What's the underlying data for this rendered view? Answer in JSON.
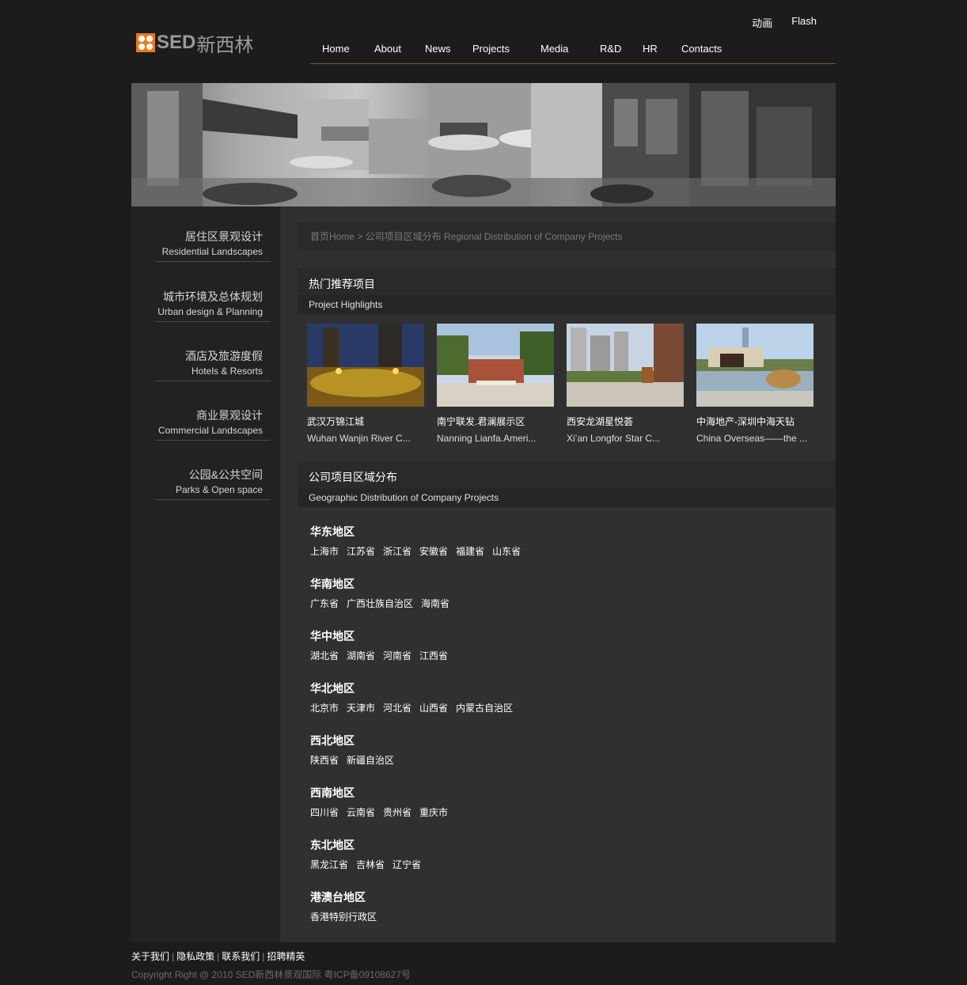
{
  "header": {
    "logo_text": "SED",
    "logo_cn": "新西林",
    "top_links": [
      "动画",
      "Flash"
    ],
    "nav": [
      "Home",
      "About",
      "News",
      "Projects",
      "Media",
      "R&D",
      "HR",
      "Contacts"
    ]
  },
  "sidebar": {
    "items": [
      {
        "cn": "居住区景观设计",
        "en": "Residential Landscapes"
      },
      {
        "cn": "城市环境及总体规划",
        "en": "Urban design & Planning"
      },
      {
        "cn": "酒店及旅游度假",
        "en": "Hotels & Resorts"
      },
      {
        "cn": "商业景观设计",
        "en": "Commercial Landscapes"
      },
      {
        "cn": "公园&公共空间",
        "en": "Parks & Open space"
      }
    ]
  },
  "breadcrumb": "首页Home > 公司项目区域分布 Regional Distribution of Company Projects",
  "highlights": {
    "title_cn": "热门推荐项目",
    "title_en": "Project Highlights",
    "items": [
      {
        "cn": "武汉万锦江城",
        "en": "Wuhan Wanjin River C..."
      },
      {
        "cn": "南宁联发.君澜展示区",
        "en": "Nanning Lianfa.Ameri..."
      },
      {
        "cn": "西安龙湖星悦荟",
        "en": "Xi’an Longfor Star C..."
      },
      {
        "cn": "中海地产-深圳中海天钻",
        "en": "China Overseas——the ..."
      }
    ]
  },
  "distribution": {
    "title_cn": "公司项目区域分布",
    "title_en": "Geographic Distribution of Company Projects",
    "regions": [
      {
        "name": "华东地区",
        "provinces": [
          "上海市",
          "江苏省",
          "浙江省",
          "安徽省",
          "福建省",
          "山东省"
        ]
      },
      {
        "name": "华南地区",
        "provinces": [
          "广东省",
          "广西壮族自治区",
          "海南省"
        ]
      },
      {
        "name": "华中地区",
        "provinces": [
          "湖北省",
          "湖南省",
          "河南省",
          "江西省"
        ]
      },
      {
        "name": "华北地区",
        "provinces": [
          "北京市",
          "天津市",
          "河北省",
          "山西省",
          "内蒙古自治区"
        ]
      },
      {
        "name": "西北地区",
        "provinces": [
          "陕西省",
          "新疆自治区"
        ]
      },
      {
        "name": "西南地区",
        "provinces": [
          "四川省",
          "云南省",
          "贵州省",
          "重庆市"
        ]
      },
      {
        "name": "东北地区",
        "provinces": [
          "黑龙江省",
          "吉林省",
          "辽宁省"
        ]
      },
      {
        "name": "港澳台地区",
        "provinces": [
          "香港特别行政区"
        ]
      }
    ]
  },
  "footer": {
    "links": [
      "关于我们",
      "隐私政策",
      "联系我们",
      "招聘精英"
    ],
    "copyright": "Copyright Right @ 2010 SED新西林景观国际 粤ICP备09108627号"
  }
}
